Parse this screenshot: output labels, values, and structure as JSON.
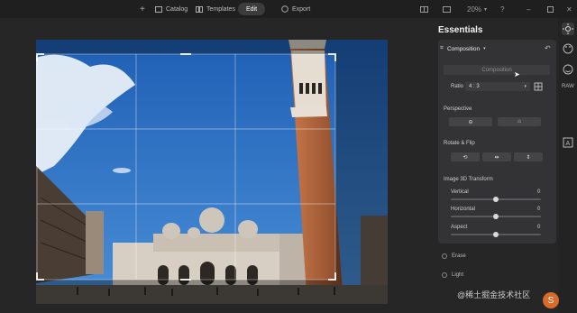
{
  "topbar": {
    "plus": "+",
    "catalog": "Catalog",
    "templates": "Templates",
    "edit": "Edit",
    "export": "Export",
    "zoom": "20%"
  },
  "panel": {
    "title": "Essentials",
    "section": "Composition",
    "composition_placeholder": "Composition",
    "ratio_label": "Ratio",
    "ratio_value": "4 : 3",
    "perspective": "Perspective",
    "rotate_flip": "Rotate & Flip",
    "transform3d": "Image 3D Transform",
    "sliders": [
      {
        "label": "Vertical",
        "value": "0"
      },
      {
        "label": "Horizontal",
        "value": "0"
      },
      {
        "label": "Aspect",
        "value": "0"
      }
    ],
    "extras": [
      "Erase",
      "Light"
    ]
  },
  "watermark": "@稀土掘金技术社区",
  "icons": {
    "rail": [
      "sun-icon",
      "palette-icon",
      "face-icon",
      "raw-icon",
      "text-icon"
    ],
    "top": [
      "plus-icon",
      "catalog-icon",
      "templates-icon",
      "export-icon"
    ]
  },
  "colors": {
    "accent": "#4a7fd0",
    "sky": "#2a6bb8",
    "tower": "#b3643a"
  }
}
